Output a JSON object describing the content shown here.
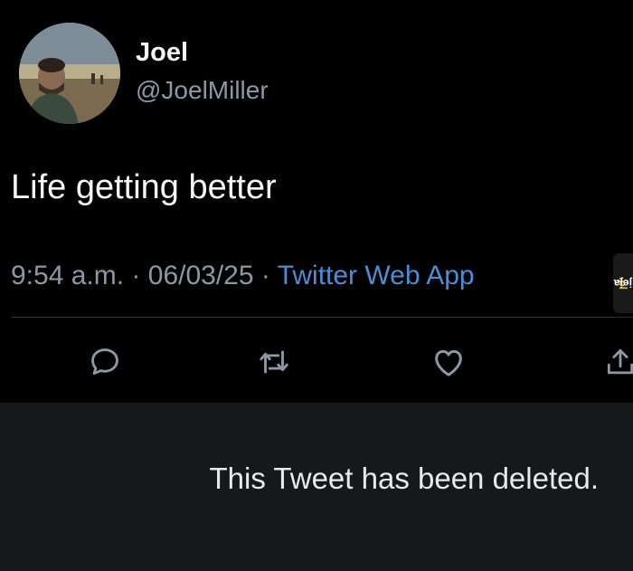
{
  "tweet": {
    "author_name": "Joel",
    "author_handle": "@JoelMiller",
    "text": "Life getting better",
    "time": "9:54 a.m.",
    "separator": "·",
    "date": "06/03/25",
    "source_app": "Twitter Web App",
    "actions": [
      {
        "name": "reply",
        "icon": "speech-bubble-icon"
      },
      {
        "name": "retweet",
        "icon": "retweet-icon"
      },
      {
        "name": "like",
        "icon": "heart-icon"
      },
      {
        "name": "share",
        "icon": "share-upload-icon"
      }
    ]
  },
  "watermark": {
    "text": "jeja",
    "suffix": ".pl"
  },
  "deleted_notice": {
    "text": "This Tweet has been deleted."
  },
  "colors": {
    "background": "#000000",
    "text": "#f5f5f5",
    "muted": "#8b98a5",
    "link": "#4a8fd6",
    "panel": "#16181c"
  }
}
